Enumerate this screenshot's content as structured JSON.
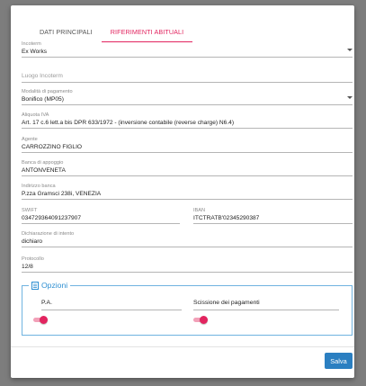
{
  "tabs": [
    {
      "label": "DATI PRINCIPALI",
      "active": false
    },
    {
      "label": "RIFERIMENTI ABITUALI",
      "active": true
    }
  ],
  "fields": {
    "incoterm": {
      "label": "Incoterm",
      "value": "Ex Works"
    },
    "luogo_incoterm": {
      "placeholder": "Luogo Incoterm"
    },
    "modalita_pagamento": {
      "label": "Modalità di pagamento",
      "value": "Bonifico (MP05)"
    },
    "aliquota_iva": {
      "label": "Aliquota IVA",
      "value": "Art. 17 c.6 lett.a bis DPR 633/1972 - (inversione contabile (reverse charge) N6.4)"
    },
    "agente": {
      "label": "Agente",
      "value": "CARROZZINO FIGLIO"
    },
    "banca_appoggio": {
      "label": "Banca di appoggio",
      "value": "ANTONVENETA"
    },
    "indirizzo_banca": {
      "label": "Indirizzo banca",
      "value": "P.zza Gramsci 238i, VENEZIA"
    },
    "swift": {
      "label": "SWIFT",
      "value": "034729364091237907"
    },
    "iban": {
      "label": "IBAN",
      "value": "ITCTRATB'02345290387"
    },
    "dichiarazione_intento": {
      "label": "Dichiarazione di intento",
      "value": "dichiaro"
    },
    "protocollo": {
      "label": "Protocollo",
      "value": "12/8"
    }
  },
  "options": {
    "title": "Opzioni",
    "pa": {
      "label": "P.A.",
      "on": true
    },
    "scissione": {
      "label": "Scissione dei pagamenti",
      "on": true
    }
  },
  "footer": {
    "save_label": "Salva"
  },
  "colors": {
    "accent": "#e2245f",
    "primary": "#2b7fc1",
    "options_border": "#6fb3e0"
  }
}
